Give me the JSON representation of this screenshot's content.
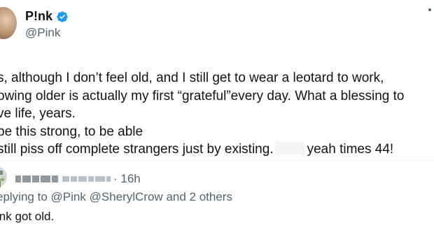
{
  "author": {
    "display_name": "P!nk",
    "handle": "@Pink",
    "verified_color": "#1d9bf0"
  },
  "tweet": {
    "lines": [
      "s, although I don’t feel old, and I still get to wear a leotard to work,",
      "owing older is actually my first “grateful”every day. What a blessing to",
      "ve life, years.",
      "be this strong, to be able"
    ],
    "last_line_before": "still piss off complete strangers just by existing.",
    "last_line_after": "yeah times 44!"
  },
  "reply": {
    "time": "· 16h",
    "replying_prefix": "eplying to",
    "mention_1": "@Pink",
    "mention_2": "@SherylCrow",
    "others": "and 2 others",
    "text": "ink got old."
  },
  "icons": {
    "verified": "verified-badge-icon",
    "more": "more-options-icon"
  }
}
